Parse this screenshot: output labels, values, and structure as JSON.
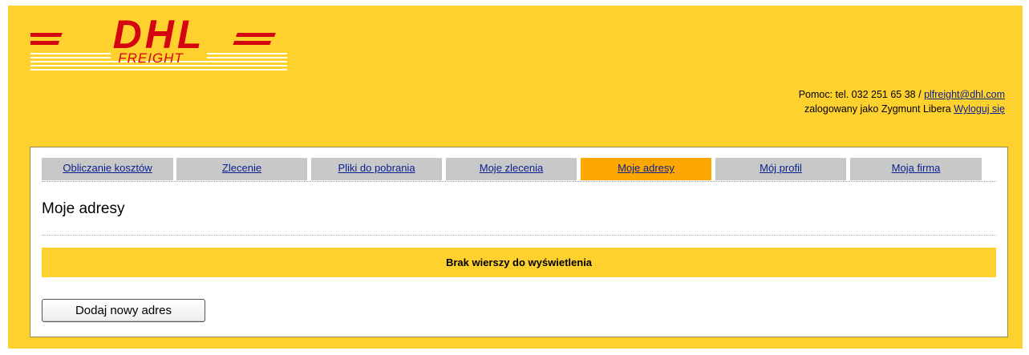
{
  "brand": {
    "logo_text": "DHL",
    "sub_text": "FREIGHT",
    "logo_color": "#d40511",
    "background_color": "#fed12e"
  },
  "header": {
    "help_text": "Pomoc: tel. 032 251 65 38 /",
    "help_email": "plfreight@dhl.com",
    "logged_in_text": "zalogowany jako Zygmunt Libera",
    "logout_label": "Wyloguj się"
  },
  "tabs": [
    {
      "label": "Obliczanie kosztów",
      "active": false
    },
    {
      "label": "Zlecenie",
      "active": false
    },
    {
      "label": "Pliki do pobrania",
      "active": false
    },
    {
      "label": "Moje zlecenia",
      "active": false
    },
    {
      "label": "Moje adresy",
      "active": true
    },
    {
      "label": "Mój profil",
      "active": false
    },
    {
      "label": "Moja firma",
      "active": false
    }
  ],
  "main": {
    "title": "Moje adresy",
    "empty_message": "Brak wierszy do wyświetlenia",
    "add_button_label": "Dodaj nowy adres"
  }
}
